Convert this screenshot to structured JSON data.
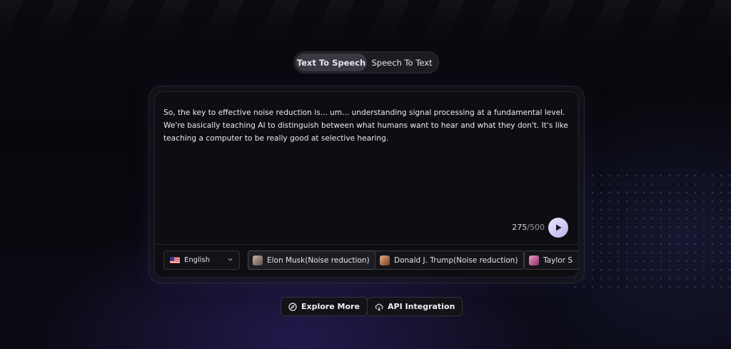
{
  "mode_tabs": [
    {
      "label": "Text To Speech",
      "active": true
    },
    {
      "label": "Speech To Text",
      "active": false
    }
  ],
  "editor": {
    "text": "So, the key to effective noise reduction is... um... understanding signal processing at a fundamental level. We're basically teaching AI to distinguish between what humans want to hear and what they don't. It's like teaching a computer to be really good at selective hearing.",
    "char_count": "275",
    "char_max": "/500"
  },
  "language": {
    "selected": "English",
    "icon": "us-flag-icon"
  },
  "voices": [
    {
      "label": "Elon Musk(Noise reduction)",
      "selected": true
    },
    {
      "label": "Donald J. Trump(Noise reduction)",
      "selected": false
    },
    {
      "label": "Taylor S",
      "selected": false
    }
  ],
  "actions": {
    "explore_label": "Explore More",
    "api_label": "API Integration"
  },
  "colors": {
    "accent": "#c8c2f4",
    "background": "#07070b"
  }
}
